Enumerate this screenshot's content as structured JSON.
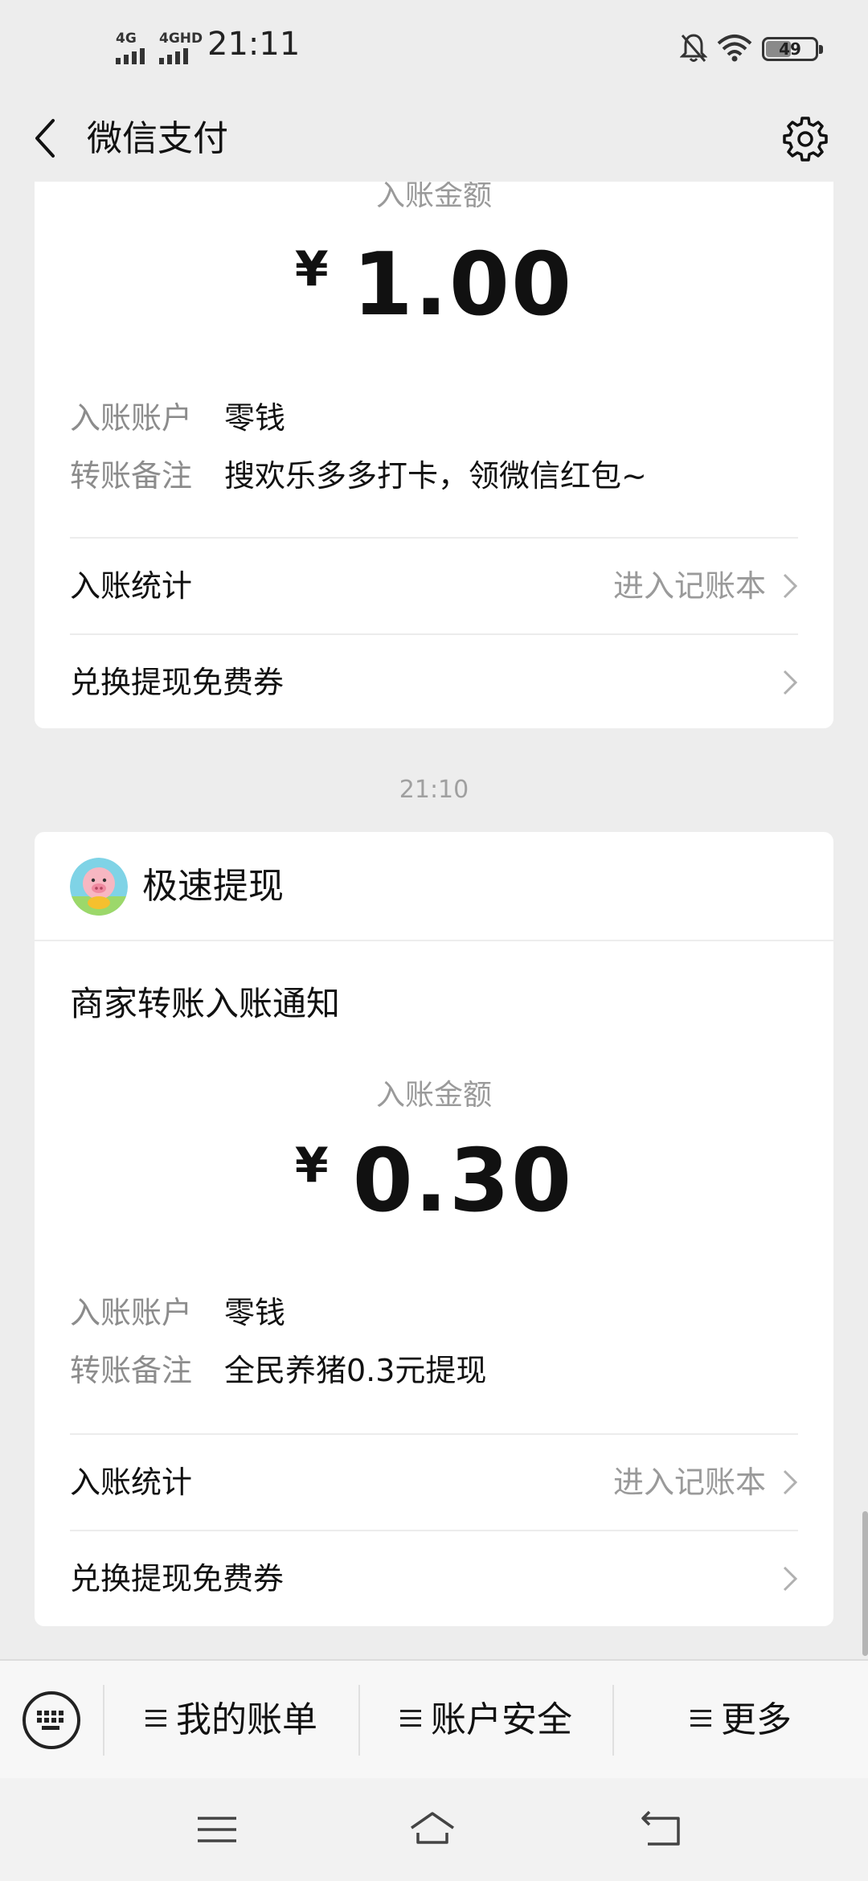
{
  "status_bar": {
    "network1": "4G",
    "network2": "4GHD",
    "time": "21:11",
    "battery": "49"
  },
  "header": {
    "title": "微信支付"
  },
  "notice1": {
    "amount_label": "入账金额",
    "currency": "¥",
    "amount": "1.00",
    "account_key": "入账账户",
    "account_value": "零钱",
    "remark_key": "转账备注",
    "remark_value": "搜欢乐多多打卡，领微信红包~",
    "stats_label": "入账统计",
    "stats_link": "进入记账本",
    "coupon_label": "兑换提现免费券"
  },
  "timestamp": "21:10",
  "notice2": {
    "app_name": "极速提现",
    "title": "商家转账入账通知",
    "amount_label": "入账金额",
    "currency": "¥",
    "amount": "0.30",
    "account_key": "入账账户",
    "account_value": "零钱",
    "remark_key": "转账备注",
    "remark_value": "全民养猪0.3元提现",
    "stats_label": "入账统计",
    "stats_link": "进入记账本",
    "coupon_label": "兑换提现免费券"
  },
  "bottom_menu": {
    "item1": "我的账单",
    "item2": "账户安全",
    "item3": "更多"
  },
  "colors": {
    "background": "#ededed",
    "card": "#ffffff",
    "secondary_text": "#9a9a9a"
  }
}
